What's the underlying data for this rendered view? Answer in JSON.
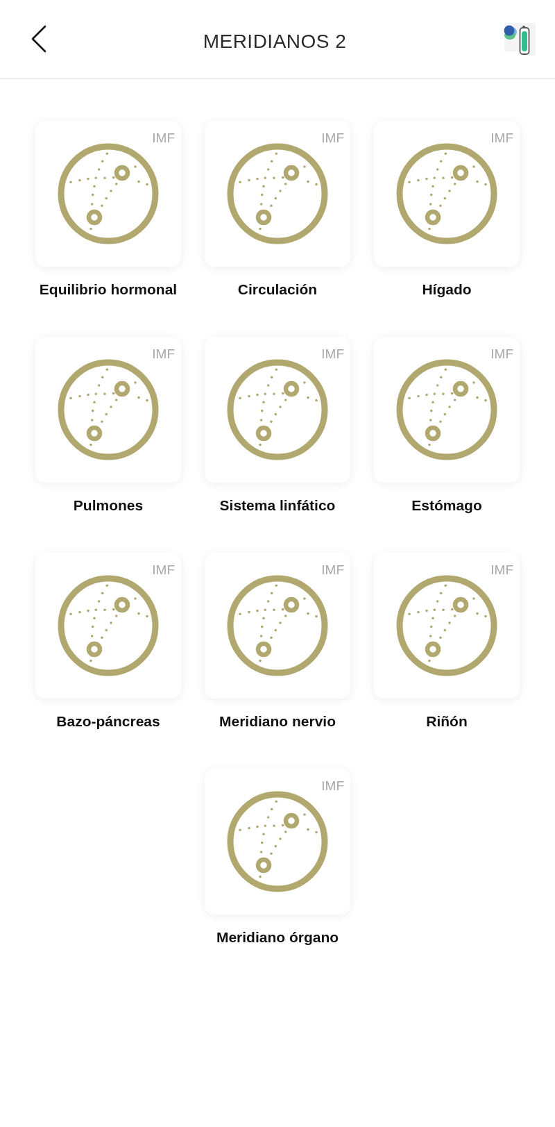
{
  "header": {
    "title": "MERIDIANOS 2"
  },
  "programs": [
    {
      "name": "Equilibrio hormonal",
      "badge": "IMF"
    },
    {
      "name": "Circulación",
      "badge": "IMF"
    },
    {
      "name": "Hígado",
      "badge": "IMF"
    },
    {
      "name": "Pulmones",
      "badge": "IMF"
    },
    {
      "name": "Sistema linfático",
      "badge": "IMF"
    },
    {
      "name": "Estómago",
      "badge": "IMF"
    },
    {
      "name": "Bazo-páncreas",
      "badge": "IMF"
    },
    {
      "name": "Meridiano nervio",
      "badge": "IMF"
    },
    {
      "name": "Riñón",
      "badge": "IMF"
    },
    {
      "name": "Meridiano órgano",
      "badge": "IMF"
    }
  ]
}
